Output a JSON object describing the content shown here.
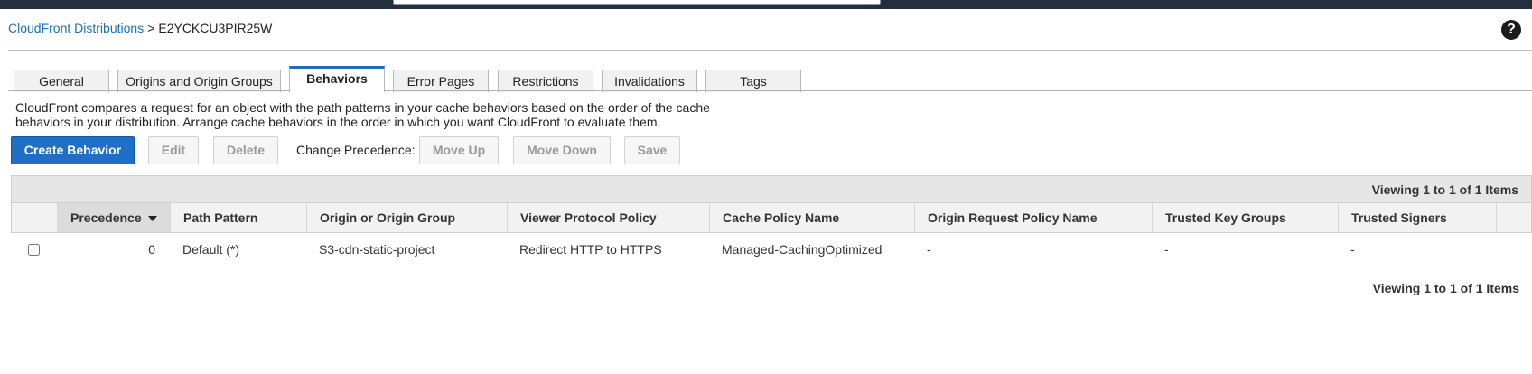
{
  "breadcrumb": {
    "parent_label": "CloudFront Distributions",
    "separator": ">",
    "current_label": "E2YCKCU3PIR25W"
  },
  "help": {
    "icon": "question-circle-icon",
    "glyph": "?"
  },
  "tabs": [
    {
      "label": "General",
      "active": false
    },
    {
      "label": "Origins and Origin Groups",
      "active": false
    },
    {
      "label": "Behaviors",
      "active": true
    },
    {
      "label": "Error Pages",
      "active": false
    },
    {
      "label": "Restrictions",
      "active": false
    },
    {
      "label": "Invalidations",
      "active": false
    },
    {
      "label": "Tags",
      "active": false
    }
  ],
  "description": "CloudFront compares a request for an object with the path patterns in your cache behaviors based on the order of the cache behaviors in your distribution. Arrange cache behaviors in the order in which you want CloudFront to evaluate them.",
  "toolbar": {
    "create_label": "Create Behavior",
    "edit_label": "Edit",
    "delete_label": "Delete",
    "change_precedence_label": "Change Precedence:",
    "move_up_label": "Move Up",
    "move_down_label": "Move Down",
    "save_label": "Save"
  },
  "table": {
    "viewing_top": "Viewing 1 to 1 of 1 Items",
    "viewing_bottom": "Viewing 1 to 1 of 1 Items",
    "sort_icon": "sort-descending-icon",
    "columns": [
      "Precedence",
      "Path Pattern",
      "Origin or Origin Group",
      "Viewer Protocol Policy",
      "Cache Policy Name",
      "Origin Request Policy Name",
      "Trusted Key Groups",
      "Trusted Signers"
    ],
    "rows": [
      {
        "checked": false,
        "precedence": "0",
        "path_pattern": "Default (*)",
        "origin": "S3-cdn-static-project",
        "viewer_protocol_policy": "Redirect HTTP to HTTPS",
        "cache_policy_name": "Managed-CachingOptimized",
        "origin_request_policy_name": "-",
        "trusted_key_groups": "-",
        "trusted_signers": "-"
      }
    ]
  },
  "colors": {
    "topbar": "#232f3e",
    "link": "#1a6fbf",
    "primary_button": "#1f6fc8",
    "active_tab_accent": "#1a6fbf"
  }
}
